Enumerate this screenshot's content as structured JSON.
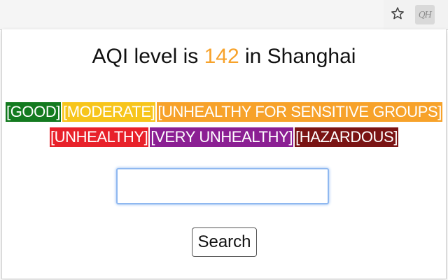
{
  "toolbar": {
    "star_icon": "star-icon",
    "extension_label": "QH"
  },
  "headline": {
    "prefix": "AQI level is ",
    "value": "142",
    "suffix": " in Shanghai",
    "value_color": "#f7a22a"
  },
  "levels": [
    {
      "label": "[GOOD]",
      "color": "#137a1f"
    },
    {
      "label": "[MODERATE]",
      "color": "#f7c51b"
    },
    {
      "label": "[UNHEALTHY FOR SENSITIVE GROUPS]",
      "color": "#f7a22a"
    },
    {
      "label": "[UNHEALTHY]",
      "color": "#e8212a"
    },
    {
      "label": "[VERY UNHEALTHY]",
      "color": "#8b1f93"
    },
    {
      "label": "[HAZARDOUS]",
      "color": "#7a1414"
    }
  ],
  "search": {
    "value": "",
    "placeholder": "",
    "button_label": "Search"
  }
}
